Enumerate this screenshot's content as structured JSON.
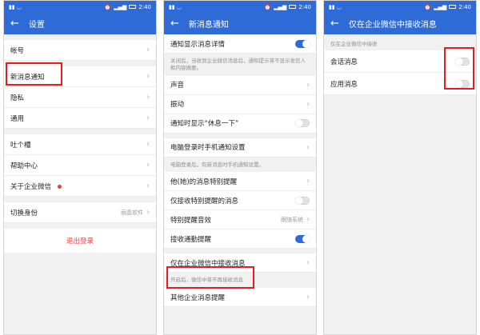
{
  "status": {
    "time": "2:40"
  },
  "colors": {
    "primary": "#2f6bd6",
    "danger": "#e64340",
    "highlight": "#e51c23"
  },
  "screen1": {
    "title": "设置",
    "items": {
      "account": "帐号",
      "new_msg": "新消息通知",
      "privacy": "隐私",
      "general": "通用",
      "feedback": "吐个槽",
      "help": "帮助中心",
      "about": "关于企业微信",
      "switch_identity": "切换身份",
      "switch_identity_value": "丽晶软件"
    },
    "logout": "退出登录"
  },
  "screen2": {
    "title": "新消息通知",
    "show_details": "通知显示消息详情",
    "show_details_note": "关闭后，当收到企业微信消息后，通知提示将不显示发信人和内容摘要。",
    "sound": "声音",
    "vibrate": "振动",
    "rest_notice": "通知时显示“休息一下”",
    "pc_login": "电脑登录时手机通知设置",
    "pc_login_note": "电脑登录后，有新消息时手机通知设置。",
    "special_remind": "他(她)的消息特别提醒",
    "only_special": "仅接收特别提醒的消息",
    "special_sound": "特别提醒音效",
    "special_sound_value": "跟随系统",
    "attendance": "接收通勤提醒",
    "only_wecom": "仅在企业微信中接收消息",
    "only_wecom_note": "开启后，微信中将不再接收消息",
    "other": "其他企业消息提醒"
  },
  "screen3": {
    "title": "仅在企业微信中接收消息",
    "section": "仅在企业微信中接收",
    "chat": "会话消息",
    "app": "应用消息"
  }
}
